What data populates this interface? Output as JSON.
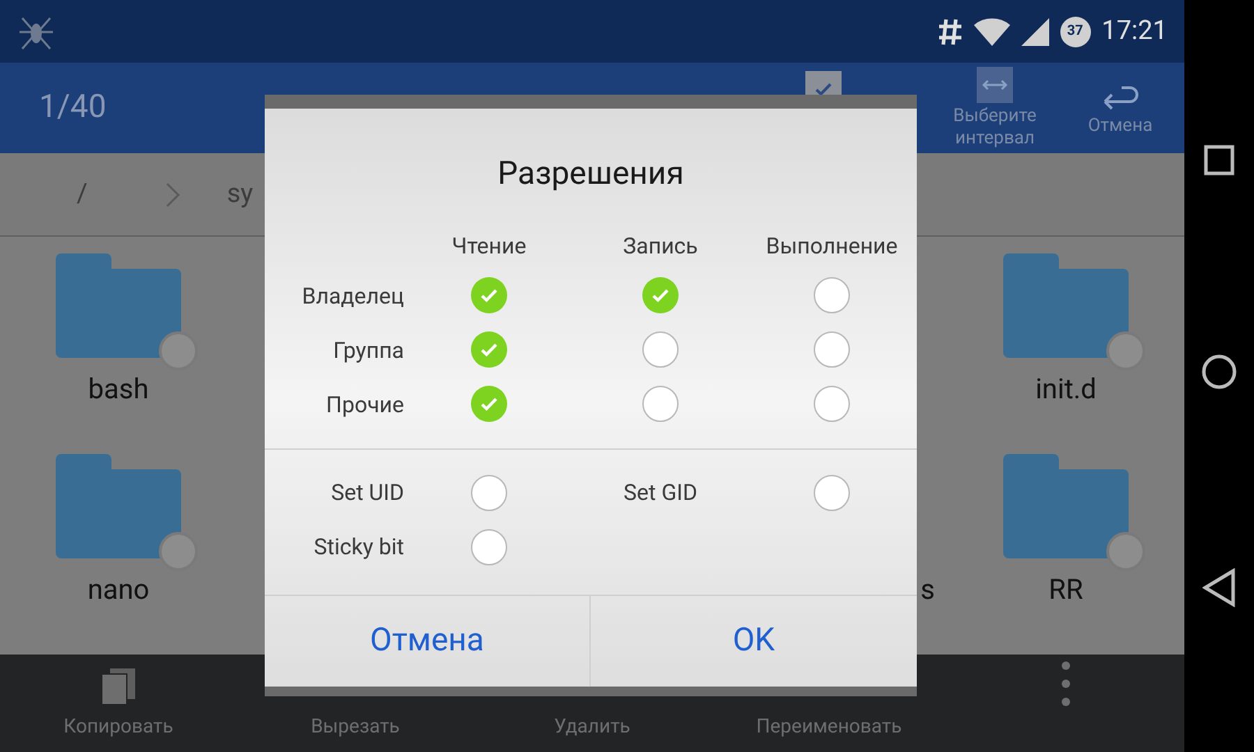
{
  "status_bar": {
    "battery": "37",
    "time": "17:21"
  },
  "toolbar": {
    "count": "1/40",
    "select_all": {
      "checked": true
    },
    "actions": [
      {
        "label": "Выберите интервал"
      },
      {
        "label": "Отмена"
      }
    ]
  },
  "breadcrumb": [
    "/",
    "sy"
  ],
  "files": [
    {
      "name": "bash",
      "selected": false
    },
    {
      "name": "init.d",
      "selected": false
    },
    {
      "name": "nano",
      "selected": false
    },
    {
      "name": "RR",
      "selected": false
    }
  ],
  "hidden_label_fragment": "s",
  "bottom_bar": [
    "Копировать",
    "Вырезать",
    "Удалить",
    "Переименовать"
  ],
  "dialog": {
    "title": "Разрешения",
    "columns": [
      "Чтение",
      "Запись",
      "Выполнение"
    ],
    "rows": [
      {
        "label": "Владелец",
        "checks": [
          true,
          true,
          false
        ]
      },
      {
        "label": "Группа",
        "checks": [
          true,
          false,
          false
        ]
      },
      {
        "label": "Прочие",
        "checks": [
          true,
          false,
          false
        ]
      }
    ],
    "specials": [
      {
        "label": "Set UID",
        "checked": false
      },
      {
        "label": "Set GID",
        "checked": false
      },
      {
        "label": "Sticky bit",
        "checked": false
      }
    ],
    "buttons": [
      "Отмена",
      "OK"
    ]
  }
}
